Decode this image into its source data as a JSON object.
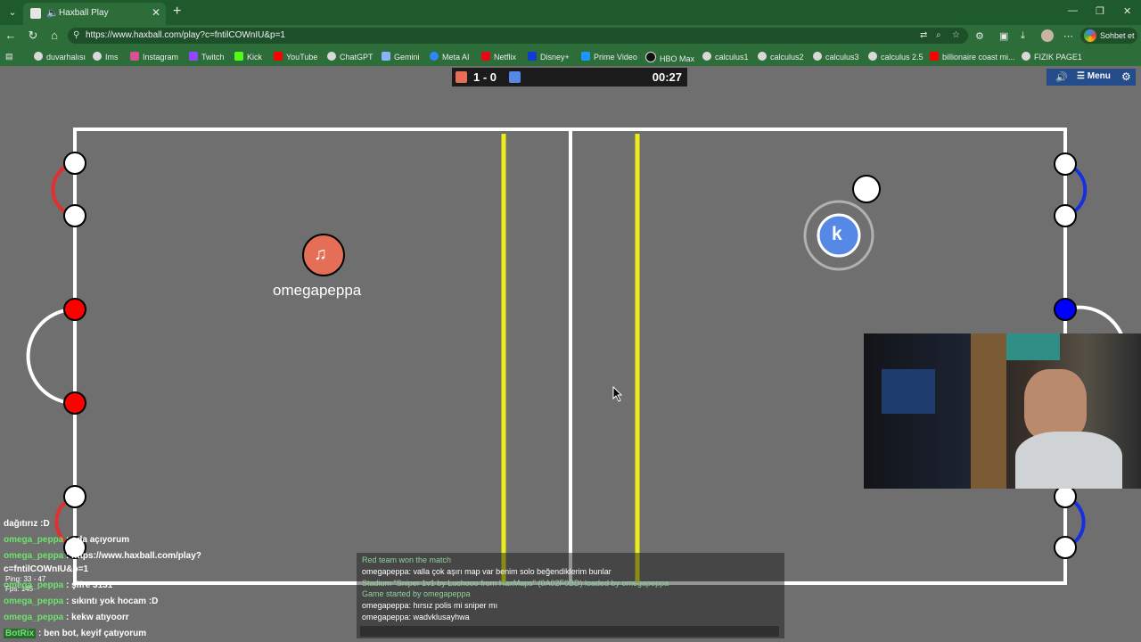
{
  "browser": {
    "tab_title": "Haxball Play",
    "url": "https://www.haxball.com/play?c=fntilCOWnIU&p=1",
    "chat_button": "Sohbet et",
    "bookmarks": [
      "duvarhalısı",
      "Ims",
      "Instagram",
      "Twitch",
      "Kick",
      "YouTube",
      "ChatGPT",
      "Gemini",
      "Meta AI",
      "Netflix",
      "Disney+",
      "Prime Video",
      "HBO Max",
      "calculus1",
      "calculus2",
      "calculus3",
      "calculus 2.5",
      "billionaire coast mi...",
      "FIZIK PAGE1"
    ]
  },
  "game": {
    "score": "1 - 0",
    "time": "00:27",
    "menu_label": "Menu",
    "red_player_name": "omegapeppa",
    "red_player_avatar": "♫",
    "blue_player_avatar": "k",
    "colors": {
      "red": "#e56e56",
      "blue": "#5689e5",
      "field": "#6f6f6f",
      "line_yellow": "#ecec1a"
    }
  },
  "stream_chat": [
    {
      "user": "",
      "msg": "dağıtırız :D"
    },
    {
      "user": "omega_peppa",
      "msg": ": oda açıyorum"
    },
    {
      "user": "omega_peppa",
      "msg": ": https://www.haxball.com/play?"
    },
    {
      "user": "",
      "msg": "c=fntilCOWnIU&p=1"
    },
    {
      "user": "omega_peppa",
      "msg": ": şifre 3131"
    },
    {
      "user": "omega_peppa",
      "msg": ": sıkıntı yok hocam :D"
    },
    {
      "user": "omega_peppa",
      "msg": ": kekw atıyoorr"
    },
    {
      "user": "BotRix",
      "msg": ": ben bot, keyif çatıyorum"
    }
  ],
  "ping_text": "Ping: 33 - 47",
  "fps_text": "Fps: 145",
  "game_chat": [
    {
      "text": "Red team won the match",
      "system": true
    },
    {
      "text": "omegapeppa: valla çok aşırı map var benim solo beğendiklerim bunlar",
      "system": false
    },
    {
      "text": "Stadium \"Sniper 1v1 by Luchooo from HaxMaps\" (0A02F0BD) loaded by omegapeppa",
      "system": true
    },
    {
      "text": "Game started by omegapeppa",
      "system": true
    },
    {
      "text": "omegapeppa: hırsız polis mi sniper mı",
      "system": false
    },
    {
      "text": "omegapeppa: wadvklusayhwa",
      "system": false
    }
  ]
}
